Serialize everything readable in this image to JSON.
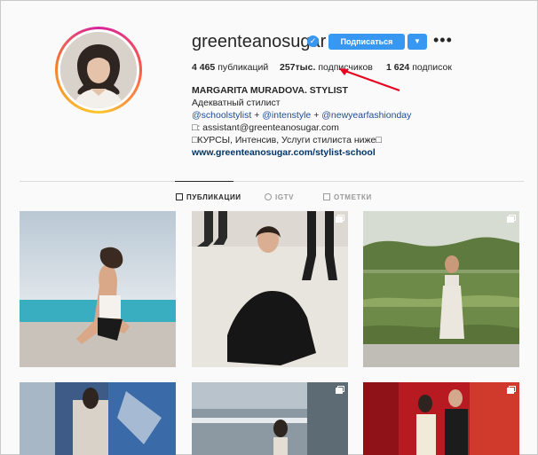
{
  "profile": {
    "username": "greenteanosugar",
    "follow_label": "Подписаться",
    "more_label": "•••",
    "stats": {
      "posts_count": "4 465",
      "posts_label": "публикаций",
      "followers_count": "257тыс.",
      "followers_label": "подписчиков",
      "following_count": "1 624",
      "following_label": "подписок"
    }
  },
  "bio": {
    "name": "MARGARITA MURADOVA. STYLIST",
    "line1": "Адекватный стилист",
    "mention1": "@schoolstylist",
    "plus1": "+",
    "mention2": "@intenstyle",
    "plus2": "+",
    "mention3": "@newyearfashionday",
    "email_line": "□: assistant@greenteanosugar.com",
    "line4": "□КУРСЫ, Интенсив, Услуги стилиста ниже□",
    "link": "www.greenteanosugar.com/stylist-school"
  },
  "tabs": [
    {
      "label": "ПУБЛИКАЦИИ"
    },
    {
      "label": "IGTV"
    },
    {
      "label": "ОТМЕТКИ"
    }
  ],
  "colors": {
    "accent": "#3897f0",
    "arrow": "#e8001c"
  }
}
